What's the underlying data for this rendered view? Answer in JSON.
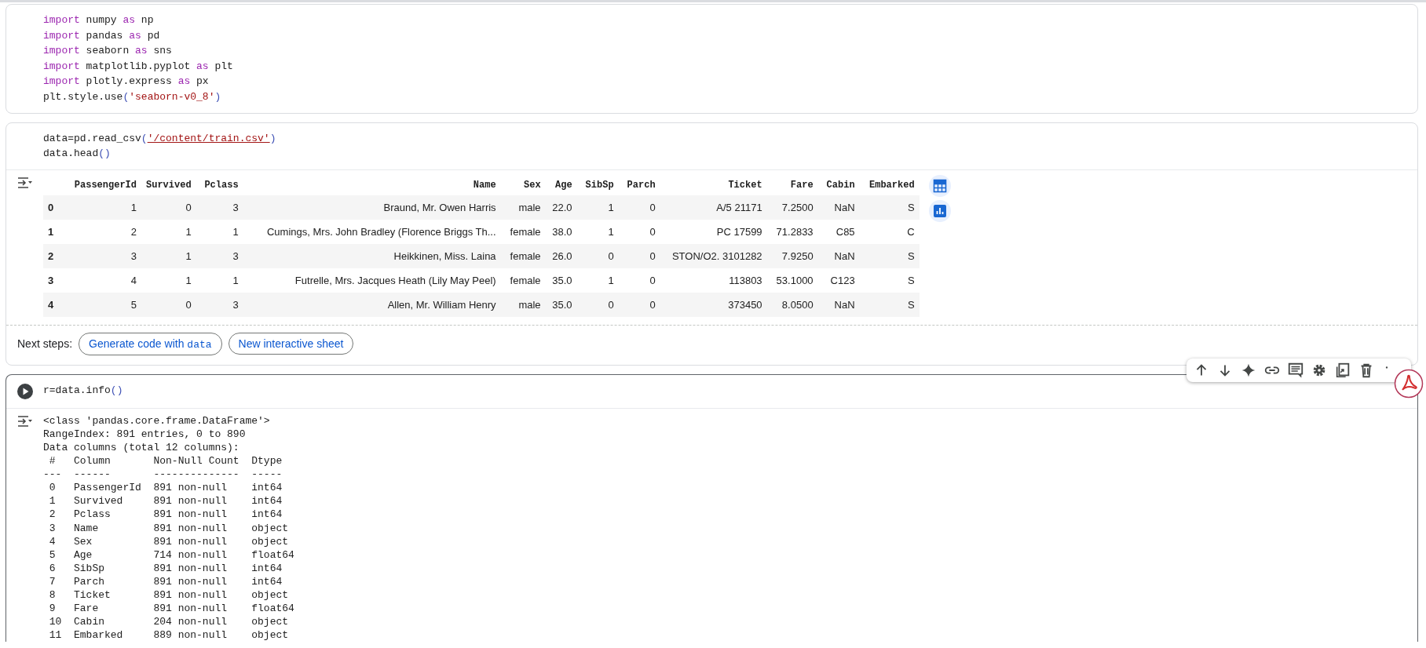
{
  "cells": [
    {
      "run_button": false,
      "code": [
        [
          {
            "kind": "keyword",
            "text": "import"
          },
          {
            "kind": "plain",
            "text": " numpy "
          },
          {
            "kind": "keyword",
            "text": "as"
          },
          {
            "kind": "plain",
            "text": " np"
          }
        ],
        [
          {
            "kind": "keyword",
            "text": "import"
          },
          {
            "kind": "plain",
            "text": " pandas "
          },
          {
            "kind": "keyword",
            "text": "as"
          },
          {
            "kind": "plain",
            "text": " pd"
          }
        ],
        [
          {
            "kind": "keyword",
            "text": "import"
          },
          {
            "kind": "plain",
            "text": " seaborn "
          },
          {
            "kind": "keyword",
            "text": "as"
          },
          {
            "kind": "plain",
            "text": " sns"
          }
        ],
        [
          {
            "kind": "keyword",
            "text": "import"
          },
          {
            "kind": "plain",
            "text": " matplotlib.pyplot "
          },
          {
            "kind": "keyword",
            "text": "as"
          },
          {
            "kind": "plain",
            "text": " plt"
          }
        ],
        [
          {
            "kind": "keyword",
            "text": "import"
          },
          {
            "kind": "plain",
            "text": " plotly.express "
          },
          {
            "kind": "keyword",
            "text": "as"
          },
          {
            "kind": "plain",
            "text": " px"
          }
        ],
        [
          {
            "kind": "plain",
            "text": "plt.style.use"
          },
          {
            "kind": "paren",
            "text": "("
          },
          {
            "kind": "string",
            "text": "'seaborn-v0_8'"
          },
          {
            "kind": "paren",
            "text": ")"
          }
        ]
      ]
    },
    {
      "run_button": false,
      "code": [
        [
          {
            "kind": "plain",
            "text": "data=pd.read_csv"
          },
          {
            "kind": "paren",
            "text": "("
          },
          {
            "kind": "link_string",
            "text": "'/content/train.csv'"
          },
          {
            "kind": "paren",
            "text": ")"
          }
        ],
        [
          {
            "kind": "plain",
            "text": "data.head"
          },
          {
            "kind": "paren",
            "text": "()"
          }
        ]
      ],
      "output": {
        "kind": "table",
        "columns": [
          "",
          "PassengerId",
          "Survived",
          "Pclass",
          "Name",
          "Sex",
          "Age",
          "SibSp",
          "Parch",
          "Ticket",
          "Fare",
          "Cabin",
          "Embarked"
        ],
        "rows": [
          [
            "0",
            "1",
            "0",
            "3",
            "Braund, Mr. Owen Harris",
            "male",
            "22.0",
            "1",
            "0",
            "A/5 21171",
            "7.2500",
            "NaN",
            "S"
          ],
          [
            "1",
            "2",
            "1",
            "1",
            "Cumings, Mrs. John Bradley (Florence Briggs Th...",
            "female",
            "38.0",
            "1",
            "0",
            "PC 17599",
            "71.2833",
            "C85",
            "C"
          ],
          [
            "2",
            "3",
            "1",
            "3",
            "Heikkinen, Miss. Laina",
            "female",
            "26.0",
            "0",
            "0",
            "STON/O2. 3101282",
            "7.9250",
            "NaN",
            "S"
          ],
          [
            "3",
            "4",
            "1",
            "1",
            "Futrelle, Mrs. Jacques Heath (Lily May Peel)",
            "female",
            "35.0",
            "1",
            "0",
            "113803",
            "53.1000",
            "C123",
            "S"
          ],
          [
            "4",
            "5",
            "0",
            "3",
            "Allen, Mr. William Henry",
            "male",
            "35.0",
            "0",
            "0",
            "373450",
            "8.0500",
            "NaN",
            "S"
          ]
        ],
        "next_steps": {
          "label": "Next steps:",
          "buttons": [
            {
              "text": "Generate code with",
              "code": "data"
            },
            {
              "text": "New interactive sheet"
            }
          ]
        }
      }
    },
    {
      "run_button": true,
      "code": [
        [
          {
            "kind": "plain",
            "text": "r=data.info"
          },
          {
            "kind": "paren",
            "text": "()"
          }
        ]
      ],
      "output": {
        "kind": "text",
        "lines": [
          "<class 'pandas.core.frame.DataFrame'>",
          "RangeIndex: 891 entries, 0 to 890",
          "Data columns (total 12 columns):",
          " #   Column       Non-Null Count  Dtype  ",
          "---  ------       --------------  -----  ",
          " 0   PassengerId  891 non-null    int64  ",
          " 1   Survived     891 non-null    int64  ",
          " 2   Pclass       891 non-null    int64  ",
          " 3   Name         891 non-null    object ",
          " 4   Sex          891 non-null    object ",
          " 5   Age          714 non-null    float64",
          " 6   SibSp        891 non-null    int64  ",
          " 7   Parch        891 non-null    int64  ",
          " 8   Ticket       891 non-null    object ",
          " 9   Fare         891 non-null    float64",
          " 10  Cabin        204 non-null    object ",
          " 11  Embarked     889 non-null    object "
        ]
      }
    }
  ]
}
